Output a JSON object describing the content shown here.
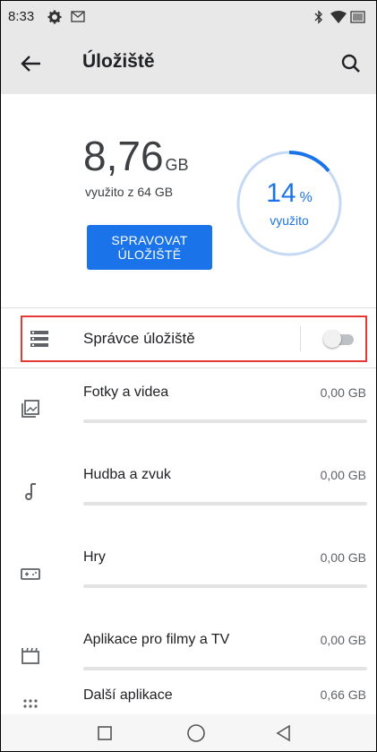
{
  "status_bar": {
    "time": "8:33"
  },
  "app_bar": {
    "title": "Úložiště"
  },
  "summary": {
    "used_value": "8,76",
    "used_unit": "GB",
    "used_of": "využito z 64 GB",
    "manage_button_line1": "SPRAVOVAT",
    "manage_button_line2": "ÚLOŽIŠTĚ",
    "percent_value": "14",
    "percent_sign": "%",
    "percent_label": "využito",
    "percent_fraction": 0.14
  },
  "storage_manager": {
    "label": "Správce úložiště",
    "enabled": false
  },
  "categories": [
    {
      "label": "Fotky a videa",
      "size": "0,00 GB",
      "icon": "photo-icon"
    },
    {
      "label": "Hudba a zvuk",
      "size": "0,00 GB",
      "icon": "music-note-icon"
    },
    {
      "label": "Hry",
      "size": "0,00 GB",
      "icon": "gamepad-icon"
    },
    {
      "label": "Aplikace pro filmy a TV",
      "size": "0,00 GB",
      "icon": "movie-icon"
    },
    {
      "label": "Další aplikace",
      "size": "0,66 GB",
      "icon": "apps-icon"
    }
  ],
  "colors": {
    "accent": "#1a73e8",
    "ring_track": "#c5d9f4",
    "highlight_border": "#e53935"
  }
}
